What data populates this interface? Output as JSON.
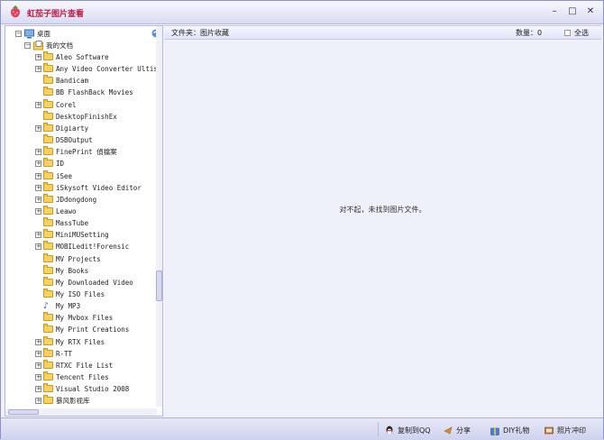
{
  "app": {
    "title": "虹茄子图片查看",
    "colors": {
      "title": "#c01a48",
      "border": "#8c8fd0",
      "folder": "#f7d260"
    }
  },
  "window_controls": {
    "minimize": "–",
    "maximize": "□",
    "close": "✕"
  },
  "tree": {
    "desktop": "桌面",
    "my_docs": "我的文档",
    "items": [
      {
        "label": "Aleo Software",
        "expandable": true
      },
      {
        "label": "Any Video Converter Ultis",
        "expandable": true
      },
      {
        "label": "Bandicam",
        "expandable": false
      },
      {
        "label": "BB FlashBack Movies",
        "expandable": false
      },
      {
        "label": "Corel",
        "expandable": true
      },
      {
        "label": "DesktopFinishEx",
        "expandable": false
      },
      {
        "label": "Digiarty",
        "expandable": true
      },
      {
        "label": "DSBOutput",
        "expandable": false
      },
      {
        "label": "FinePrint 偵檔案",
        "expandable": true
      },
      {
        "label": "ID",
        "expandable": true
      },
      {
        "label": "iSee",
        "expandable": true
      },
      {
        "label": "iSkysoft Video Editor",
        "expandable": true
      },
      {
        "label": "JDdongdong",
        "expandable": true
      },
      {
        "label": "Leawo",
        "expandable": true
      },
      {
        "label": "MassTube",
        "expandable": false
      },
      {
        "label": "MiniMUSetting",
        "expandable": true
      },
      {
        "label": "MOBILedit!Forensic",
        "expandable": true
      },
      {
        "label": "MV Projects",
        "expandable": false
      },
      {
        "label": "My Books",
        "expandable": false
      },
      {
        "label": "My Downloaded Video",
        "expandable": false
      },
      {
        "label": "My ISO Files",
        "expandable": false
      },
      {
        "label": "My MP3",
        "expandable": false,
        "icon": "music-note-icon"
      },
      {
        "label": "My Mvbox Files",
        "expandable": false
      },
      {
        "label": "My Print Creations",
        "expandable": false
      },
      {
        "label": "My RTX Files",
        "expandable": true
      },
      {
        "label": "R-TT",
        "expandable": true
      },
      {
        "label": "RTXC File List",
        "expandable": true
      },
      {
        "label": "Tencent Files",
        "expandable": true
      },
      {
        "label": "Visual Studio 2008",
        "expandable": true
      },
      {
        "label": "暴风影视库",
        "expandable": true
      }
    ]
  },
  "content": {
    "folder_label": "文件夹：图片收藏",
    "count_label": "数量：0",
    "select_all": "全选",
    "empty_message": "对不起，未找到图片文件。"
  },
  "toolbar": {
    "copy_qq": "复制到QQ",
    "share": "分享",
    "diy_gift": "DIY礼物",
    "print_photo": "照片冲印"
  }
}
